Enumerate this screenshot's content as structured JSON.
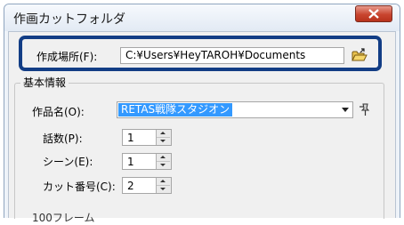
{
  "window": {
    "title": "作画カットフォルダ"
  },
  "location": {
    "label": "作成場所(F):",
    "value": "C:¥Users¥HeyTAROH¥Documents"
  },
  "basic_info": {
    "group_title": "基本情報",
    "title_label": "作品名(O):",
    "title_value": "RETAS戦隊スタジオン",
    "episode_label": "話数(P):",
    "episode_value": "1",
    "scene_label": "シーン(E):",
    "scene_value": "1",
    "cut_label": "カット番号(C):",
    "cut_value": "2"
  },
  "partial_text": "100フレーム",
  "colors": {
    "highlight_border": "#123d85",
    "selection": "#3399ff",
    "close_button": "#c8452f"
  }
}
